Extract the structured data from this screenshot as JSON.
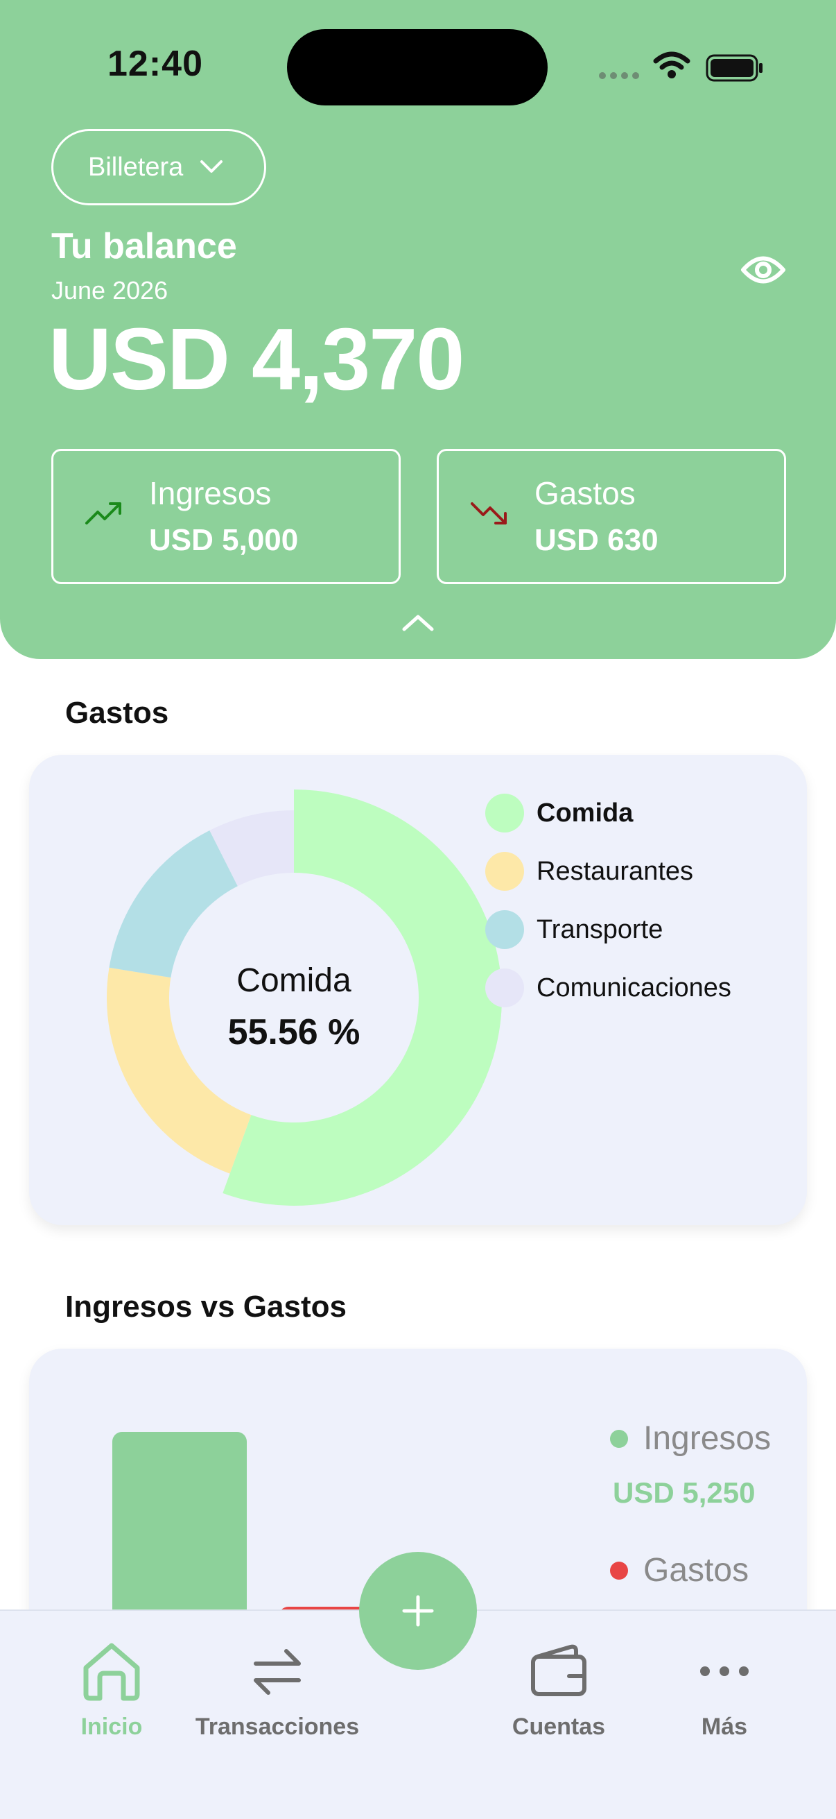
{
  "status_bar": {
    "time": "12:40"
  },
  "header": {
    "wallet_selector": "Billetera",
    "balance_title": "Tu balance",
    "balance_date": "June 2026",
    "balance_amount": "USD 4,370",
    "income_label": "Ingresos",
    "income_value": "USD 5,000",
    "expense_label": "Gastos",
    "expense_value": "USD 630"
  },
  "expenses_section": {
    "title": "Gastos",
    "center_label": "Comida",
    "center_value": "55.56 %"
  },
  "income_vs_expenses": {
    "title": "Ingresos vs Gastos",
    "income_label": "Ingresos",
    "income_value": "USD 5,250",
    "expense_label": "Gastos"
  },
  "chart_data": [
    {
      "type": "pie",
      "title": "Gastos",
      "categories": [
        "Comida",
        "Restaurantes",
        "Transporte",
        "Comunicaciones"
      ],
      "values": [
        55.56,
        22.0,
        15.0,
        7.44
      ],
      "colors": [
        "#bdfdbf",
        "#fde8a8",
        "#b3dfe6",
        "#e6e6f8"
      ],
      "legend_position": "right"
    },
    {
      "type": "bar",
      "title": "Ingresos vs Gastos",
      "categories": [
        "Ingresos",
        "Gastos"
      ],
      "values": [
        5250,
        630
      ],
      "colors": [
        "#8dd19a",
        "#e84545"
      ],
      "legend_position": "right"
    }
  ],
  "bottom_nav": {
    "items": [
      {
        "label": "Inicio",
        "icon": "home-icon",
        "active": true
      },
      {
        "label": "Transacciones",
        "icon": "transfer-icon",
        "active": false
      },
      {
        "label": "Cuentas",
        "icon": "wallet-icon",
        "active": false
      },
      {
        "label": "Más",
        "icon": "more-icon",
        "active": false
      }
    ],
    "fab_icon": "plus-icon"
  },
  "colors": {
    "primary": "#8dd19a",
    "card_background": "#eef1fb",
    "income_arrow": "#1a8a1a",
    "expense_arrow": "#9a1a1a",
    "expense_bar": "#e84545"
  }
}
